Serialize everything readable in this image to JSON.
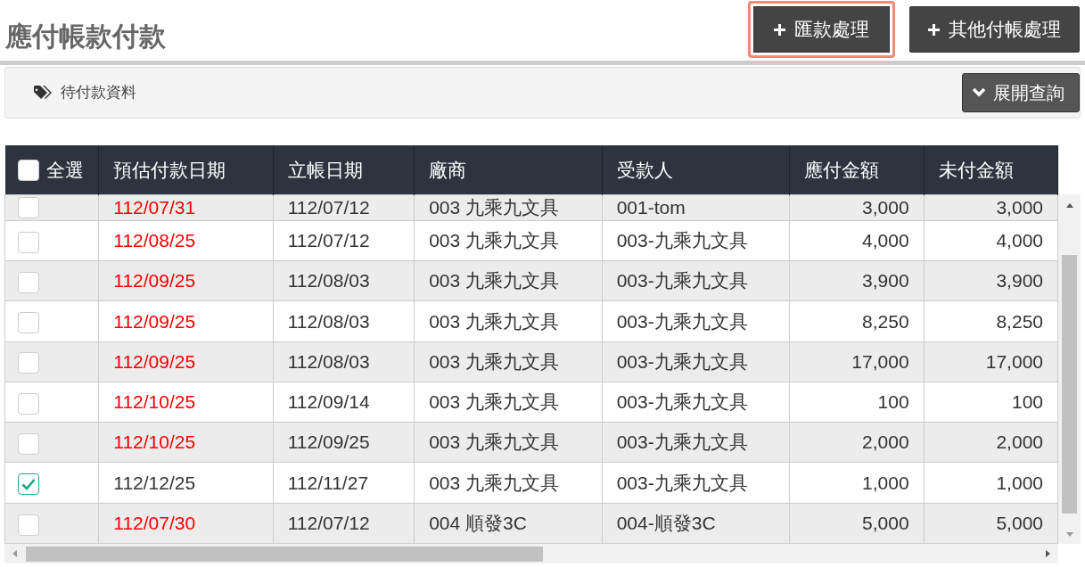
{
  "page_title": "應付帳款付款",
  "actions": [
    {
      "label": "匯款處理",
      "highlighted": true
    },
    {
      "label": "其他付帳處理",
      "highlighted": false
    }
  ],
  "panel": {
    "label": "待付款資料",
    "toggle": "展開查詢"
  },
  "table": {
    "select_all": {
      "label": "全選",
      "checked": false
    },
    "columns": [
      "預估付款日期",
      "立帳日期",
      "廠商",
      "受款人",
      "應付金額",
      "未付金額"
    ],
    "rows": [
      {
        "checked": false,
        "overdue": true,
        "cells": [
          "112/07/31",
          "112/07/12",
          "003 九乘九文具",
          "001-tom",
          "3,000",
          "3,000"
        ]
      },
      {
        "checked": false,
        "overdue": true,
        "cells": [
          "112/08/25",
          "112/07/12",
          "003 九乘九文具",
          "003-九乘九文具",
          "4,000",
          "4,000"
        ]
      },
      {
        "checked": false,
        "overdue": true,
        "cells": [
          "112/09/25",
          "112/08/03",
          "003 九乘九文具",
          "003-九乘九文具",
          "3,900",
          "3,900"
        ]
      },
      {
        "checked": false,
        "overdue": true,
        "cells": [
          "112/09/25",
          "112/08/03",
          "003 九乘九文具",
          "003-九乘九文具",
          "8,250",
          "8,250"
        ]
      },
      {
        "checked": false,
        "overdue": true,
        "cells": [
          "112/09/25",
          "112/08/03",
          "003 九乘九文具",
          "003-九乘九文具",
          "17,000",
          "17,000"
        ]
      },
      {
        "checked": false,
        "overdue": true,
        "cells": [
          "112/10/25",
          "112/09/14",
          "003 九乘九文具",
          "003-九乘九文具",
          "100",
          "100"
        ]
      },
      {
        "checked": false,
        "overdue": true,
        "cells": [
          "112/10/25",
          "112/09/25",
          "003 九乘九文具",
          "003-九乘九文具",
          "2,000",
          "2,000"
        ]
      },
      {
        "checked": true,
        "overdue": false,
        "cells": [
          "112/12/25",
          "112/11/27",
          "003 九乘九文具",
          "003-九乘九文具",
          "1,000",
          "1,000"
        ]
      },
      {
        "checked": false,
        "overdue": true,
        "cells": [
          "112/07/30",
          "112/07/12",
          "004 順發3C",
          "004-順發3C",
          "5,000",
          "5,000"
        ]
      }
    ]
  }
}
